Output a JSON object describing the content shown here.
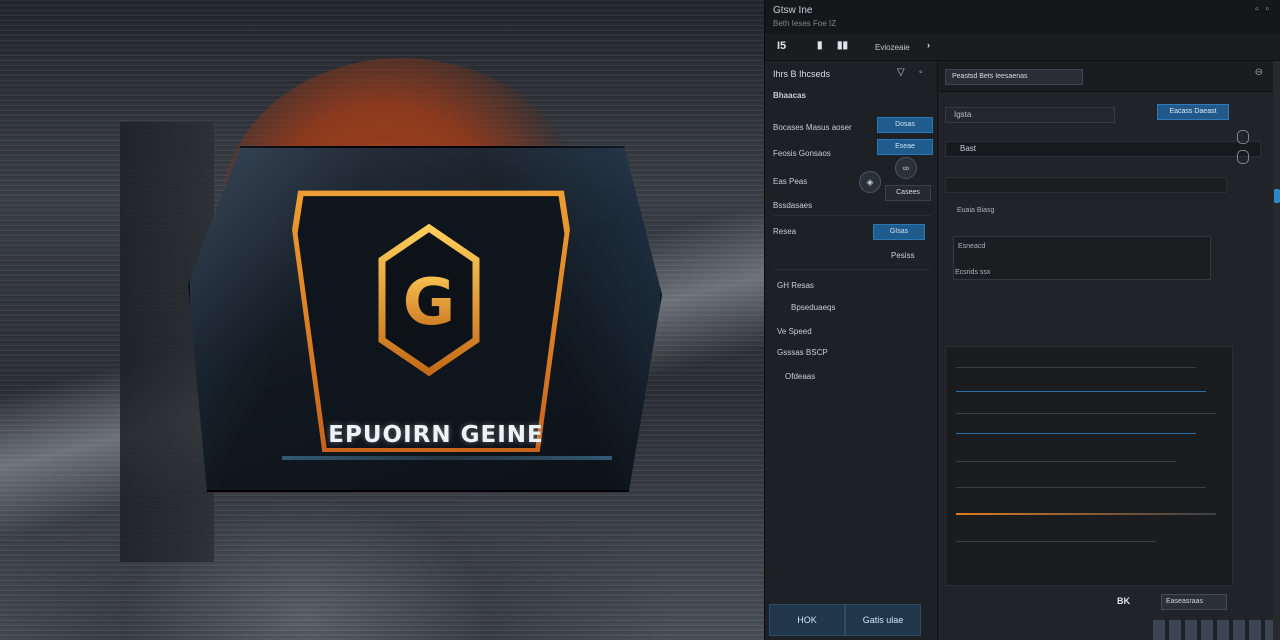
{
  "hero": {
    "brand_text": "EPUOIRN GEINE",
    "logo_letter": "G"
  },
  "titlebar": {
    "title": "Gtsw  Ine",
    "subtitle": "Beth  Ieses  Foe  IZ"
  },
  "toolbar": {
    "logo": "I5",
    "label": "Eviozeaie"
  },
  "left_panel": {
    "header": "Ihrs B  Ihcseds",
    "row_1": "Bhaacas",
    "row_2_label": "Bocases Masus aoser",
    "row_2_button": "Dosas",
    "row_3_label": "Feosis Gonsaos",
    "row_3_button": "Eseae",
    "row_4_label": "Eas Peas",
    "row_4_button": "Casees",
    "row_5_label": "Bssdasaes",
    "row_6_label": "Resea",
    "row_6_button": "GIsas",
    "row_6_value": "Pesiss",
    "tree": [
      "GH Resas",
      "Bpseduaeqs",
      "Ve Speed",
      "Gsssas BSCP",
      "Ofdeaas"
    ],
    "bottom_tabs": [
      "HOK",
      "Gatis ulae"
    ]
  },
  "main": {
    "header_field": "Peastsd Bets Ieesaenas",
    "search_placeholder": "Igsta",
    "apply_button": "Eacass Daeast",
    "prop_1": "Bast",
    "prop_label_1": "Euaia Biasg",
    "prop_box_value": "Esneacd",
    "prop_label_2": "Ecsrids ssx"
  },
  "status": {
    "code": "BK",
    "field": "Easeasraas"
  },
  "colors": {
    "accent_blue": "#2e86c8",
    "accent_orange": "#e07b1f",
    "panel_bg": "#1c1e22"
  }
}
